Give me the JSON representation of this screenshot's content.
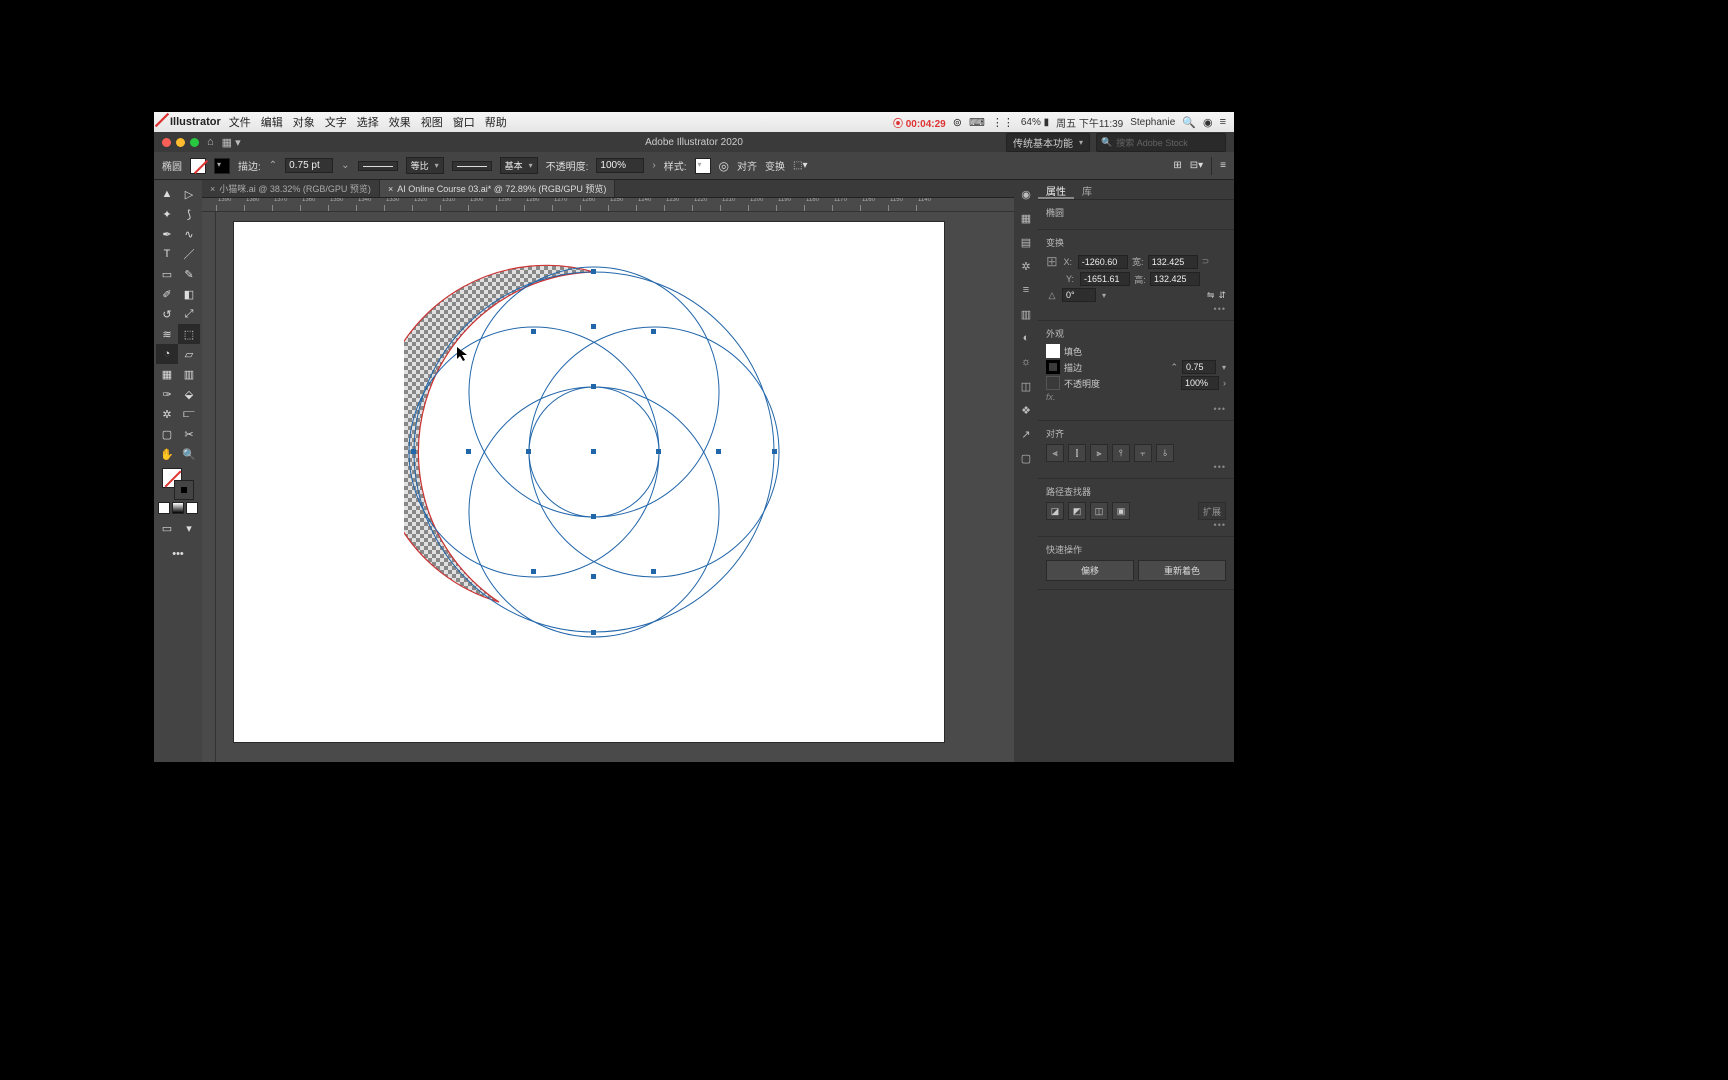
{
  "menubar": {
    "app": "Illustrator",
    "items": [
      "文件",
      "编辑",
      "对象",
      "文字",
      "选择",
      "效果",
      "视图",
      "窗口",
      "帮助"
    ],
    "status": {
      "record": "00:04:29",
      "battery": "64%",
      "datetime": "周五 下午11:39",
      "user": "Stephanie"
    }
  },
  "titlebar": {
    "title": "Adobe Illustrator 2020",
    "workspace": "传统基本功能",
    "search_placeholder": "搜索 Adobe Stock"
  },
  "controlbar": {
    "selection": "椭圆",
    "stroke_label": "描边:",
    "stroke_pt": "0.75 pt",
    "stroke_style1": "等比",
    "stroke_style2": "基本",
    "opacity_label": "不透明度:",
    "opacity": "100%",
    "style_label": "样式:",
    "align_label": "对齐",
    "transform_label": "变换"
  },
  "tabs": [
    {
      "label": "小猫咪.ai @ 38.32% (RGB/GPU 预览)",
      "active": false
    },
    {
      "label": "AI Online Course 03.ai* @ 72.89% (RGB/GPU 预览)",
      "active": true
    }
  ],
  "ruler_ticks": [
    "1390",
    "1380",
    "1370",
    "1360",
    "1350",
    "1340",
    "1330",
    "1320",
    "1310",
    "1300",
    "1290",
    "1280",
    "1270",
    "1260",
    "1250",
    "1240",
    "1230",
    "1220",
    "1210",
    "1200",
    "1190",
    "1180",
    "1170",
    "1160",
    "1150",
    "1140"
  ],
  "props": {
    "tabs": [
      "属性",
      "库"
    ],
    "section1": "椭圆",
    "transform_title": "变换",
    "x_label": "X:",
    "x": "-1260.60",
    "y_label": "Y:",
    "y": "-1651.61",
    "w_label": "宽:",
    "w": "132.425",
    "h_label": "高:",
    "h": "132.425",
    "angle_label": "△",
    "angle": "0°",
    "appearance_title": "外观",
    "fill_label": "填色",
    "stroke_label": "描边",
    "stroke_val": "0.75",
    "opacity_label": "不透明度",
    "opacity_val": "100%",
    "fx_label": "fx.",
    "align_title": "对齐",
    "pathfinder_title": "路径查找器",
    "expand_btn": "扩展",
    "quick_title": "快速操作",
    "btn1": "偏移",
    "btn2": "重新着色"
  }
}
